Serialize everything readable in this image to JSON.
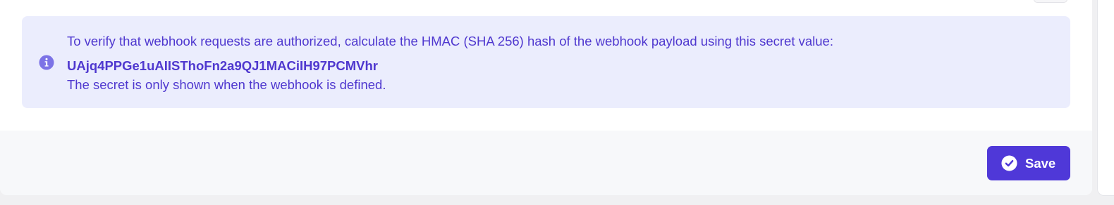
{
  "info_box": {
    "icon": "info-circle-icon",
    "message": "To verify that webhook requests are authorized, calculate the HMAC (SHA 256) hash of the webhook payload using this secret value:",
    "secret": "UAjq4PPGe1uAIISThoFn2a9QJ1MACiIH97PCMVhr",
    "note": "The secret is only shown when the webhook is defined.",
    "colors": {
      "background": "#ebedfd",
      "text": "#4f38cf",
      "icon": "#7c73e6"
    }
  },
  "footer": {
    "save_button": {
      "label": "Save",
      "icon": "check-circle-icon",
      "color": "#4f38d8"
    }
  }
}
